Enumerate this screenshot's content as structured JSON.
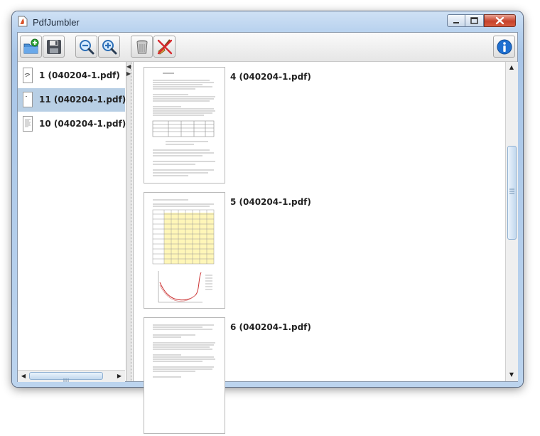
{
  "window": {
    "title": "PdfJumbler"
  },
  "toolbar": {
    "buttons": [
      {
        "name": "open-button",
        "icon": "folder-add-icon"
      },
      {
        "name": "save-button",
        "icon": "floppy-disk-icon"
      },
      {
        "name": "zoom-out-button",
        "icon": "zoom-out-icon"
      },
      {
        "name": "zoom-in-button",
        "icon": "zoom-in-icon"
      },
      {
        "name": "delete-button",
        "icon": "trash-can-icon"
      },
      {
        "name": "clear-button",
        "icon": "broom-icon"
      },
      {
        "name": "about-button",
        "icon": "info-icon"
      }
    ]
  },
  "left_list": {
    "items": [
      {
        "label": "1 (040204-1.pdf)",
        "selected": false
      },
      {
        "label": "11 (040204-1.pdf)",
        "selected": true
      },
      {
        "label": "10 (040204-1.pdf)",
        "selected": false
      }
    ]
  },
  "pages": {
    "items": [
      {
        "label": "4 (040204-1.pdf)"
      },
      {
        "label": "5 (040204-1.pdf)"
      },
      {
        "label": "6 (040204-1.pdf)"
      }
    ]
  },
  "colors": {
    "selection": "#b8cfe5",
    "title_bar": "#b7d1ee",
    "close_button": "#c7422c"
  }
}
